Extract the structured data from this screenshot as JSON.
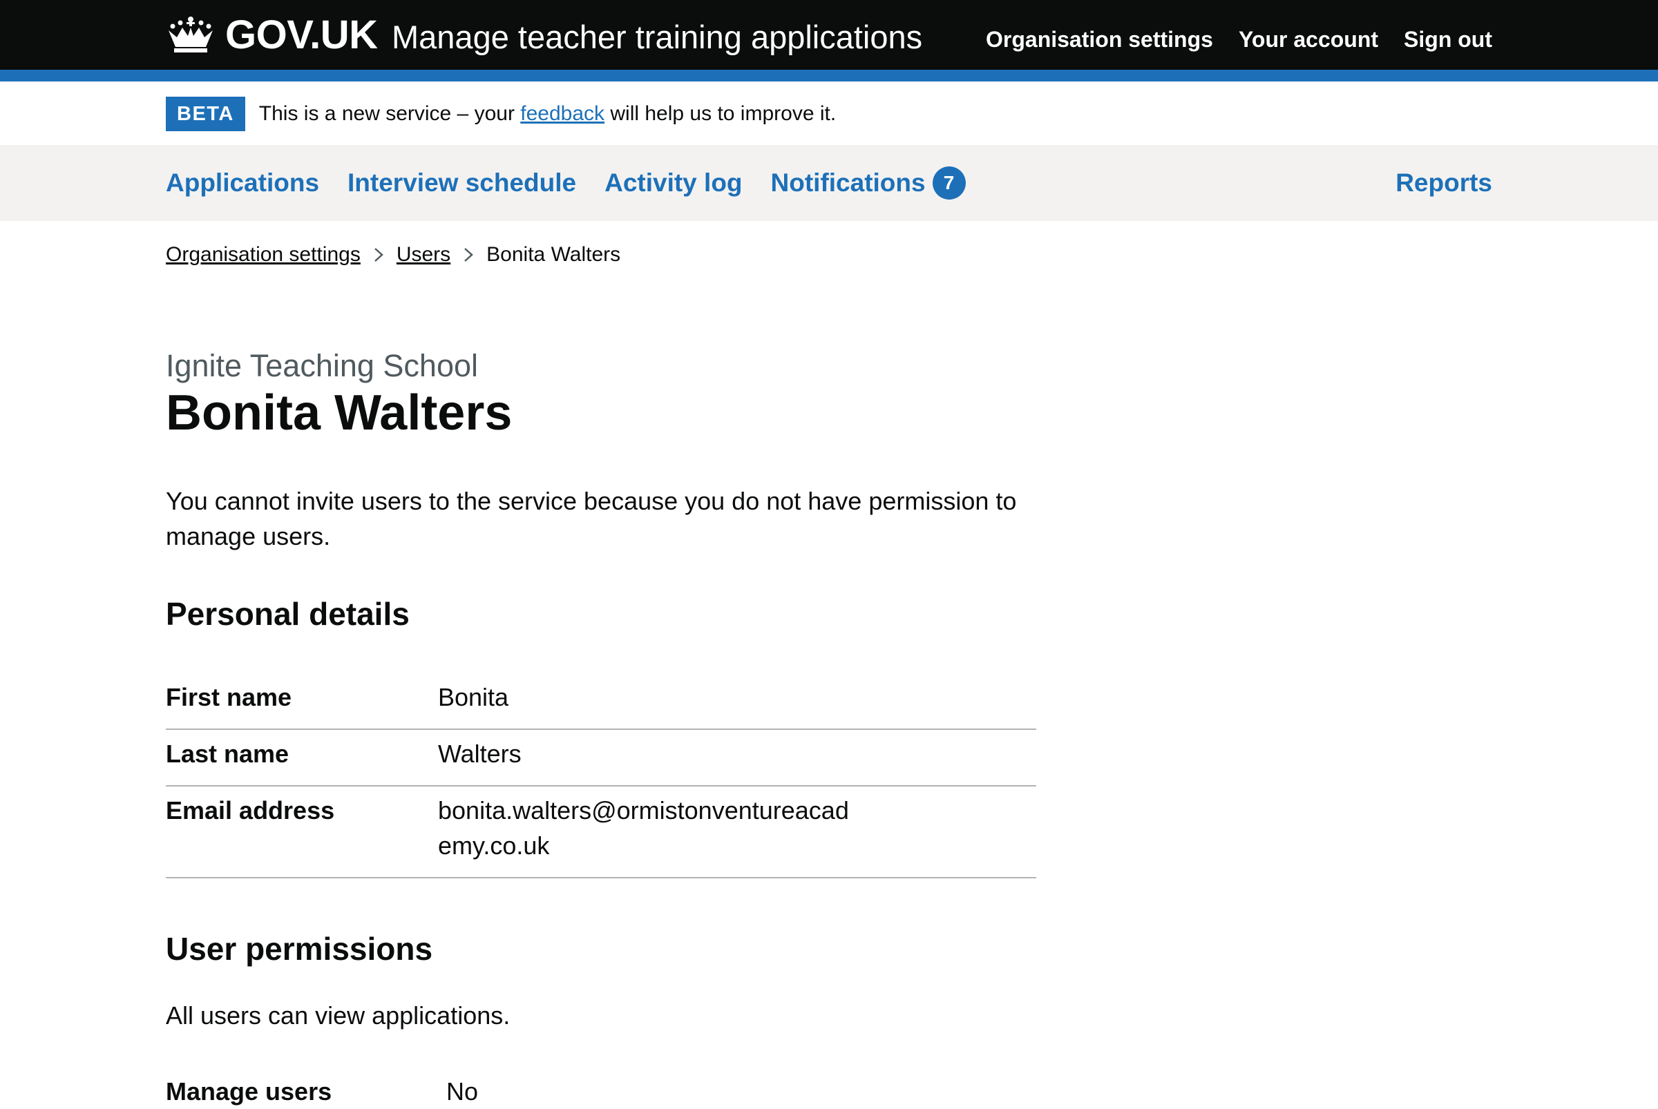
{
  "header": {
    "logo_text": "GOV.UK",
    "service_name": "Manage teacher training applications",
    "nav": [
      "Organisation settings",
      "Your account",
      "Sign out"
    ]
  },
  "phase_banner": {
    "tag": "BETA",
    "text_before": "This is a new service – your ",
    "link": "feedback",
    "text_after": " will help us to improve it."
  },
  "primary_nav": {
    "items": [
      "Applications",
      "Interview schedule",
      "Activity log",
      "Notifications"
    ],
    "notifications_count": "7",
    "right_item": "Reports"
  },
  "breadcrumb": {
    "items": [
      "Organisation settings",
      "Users"
    ],
    "current": "Bonita Walters"
  },
  "page": {
    "caption": "Ignite Teaching School",
    "title": "Bonita Walters",
    "intro": "You cannot invite users to the service because you do not have permission to manage users."
  },
  "personal_details": {
    "heading": "Personal details",
    "rows": [
      {
        "key": "First name",
        "value": "Bonita"
      },
      {
        "key": "Last name",
        "value": "Walters"
      },
      {
        "key": "Email address",
        "value": "bonita.walters@ormistonventureacademy.co.uk"
      }
    ]
  },
  "user_permissions": {
    "heading": "User permissions",
    "text": "All users can view applications.",
    "rows": [
      {
        "key": "Manage users",
        "value": "No"
      }
    ]
  },
  "colors": {
    "header_bg": "#0b0c0c",
    "brand_blue": "#1d70b8",
    "nav_bg": "#f3f2f1",
    "caption_grey": "#505a5f",
    "border_grey": "#b1b4b6"
  }
}
